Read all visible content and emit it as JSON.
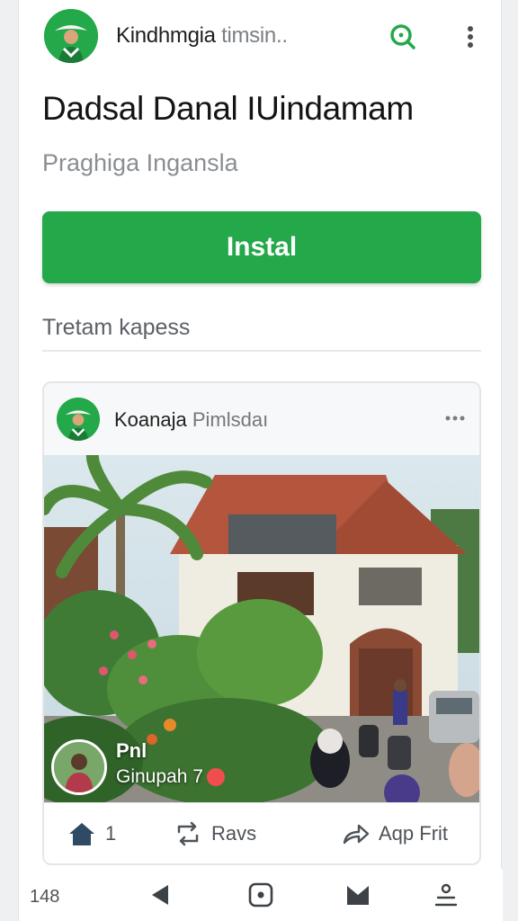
{
  "app": {
    "title_main": "Kindhmgia",
    "title_muted": "timsin..",
    "logo_icon": "avatar-hat-icon",
    "search_icon": "search-icon",
    "menu_icon": "more-vertical-icon"
  },
  "hero": {
    "headline": "Dadsal Danal IUindamam",
    "subline": "Praghiga Inganslа",
    "install_label": "Instal"
  },
  "section": {
    "label": "Tretam kapess"
  },
  "post": {
    "author_main": "Koanaja",
    "author_muted": "Pimlsdaı",
    "more_icon": "more-horizontal-icon",
    "overlay_title": "Pnl",
    "overlay_caption": "Ginupah 7",
    "actions": {
      "like_count": "1",
      "repost_label": "Ravs",
      "share_label": "Aqp Frit"
    }
  },
  "nav": {
    "count": "148",
    "items": [
      "back-icon",
      "home-icon",
      "mail-icon",
      "profile-icon"
    ]
  },
  "colors": {
    "accent": "#23a84a",
    "text": "#1c1c1c",
    "muted": "#8a8e93"
  }
}
